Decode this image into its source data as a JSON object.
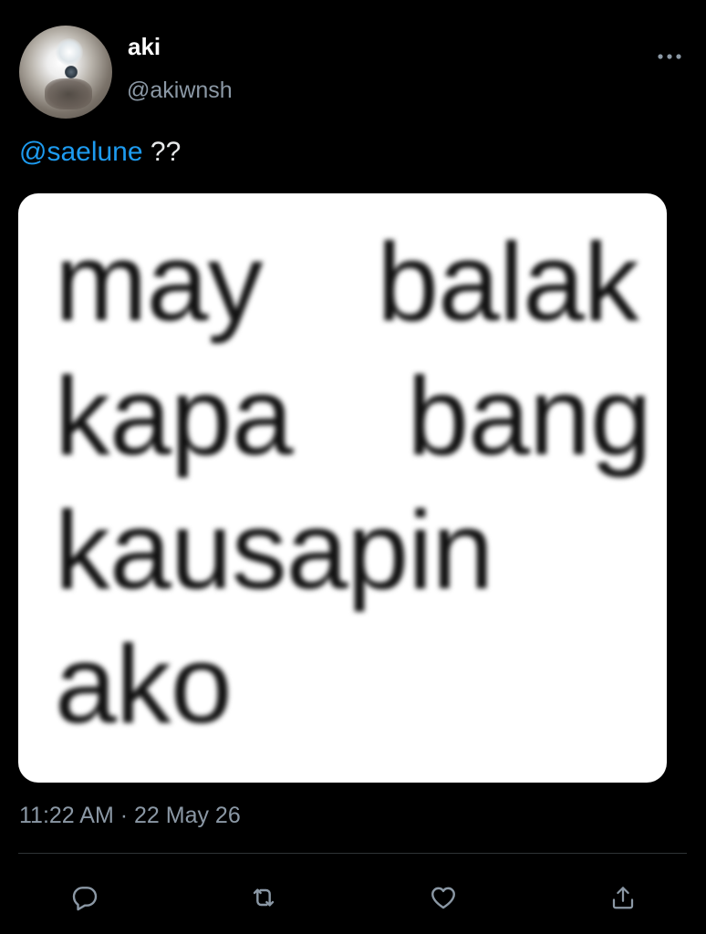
{
  "author": {
    "display_name": "aki",
    "handle": "@akiwnsh",
    "avatar_icon": "profile-photo"
  },
  "tweet": {
    "mention": "@saelune",
    "text_suffix": " ??",
    "media_text": "may  balak\nkapa  bang\nkausapin\nako",
    "timestamp": "11:22 AM · 22 May 26"
  },
  "actions": {
    "reply_icon": "reply-icon",
    "retweet_icon": "retweet-icon",
    "like_icon": "heart-icon",
    "share_icon": "share-icon",
    "more_icon": "more-icon"
  },
  "colors": {
    "background": "#000000",
    "accent": "#1d9bf0",
    "secondary_text": "#8b98a5",
    "primary_text": "#e7e9ea"
  }
}
